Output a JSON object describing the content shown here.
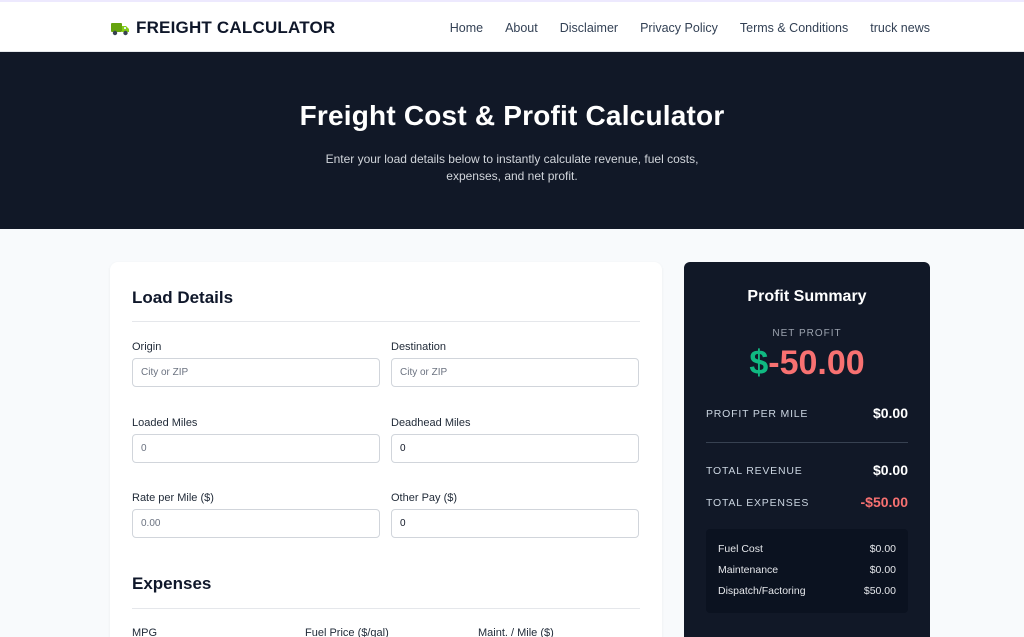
{
  "brand": {
    "name": "FREIGHT CALCULATOR",
    "icon": "truck-icon"
  },
  "nav": [
    "Home",
    "About",
    "Disclaimer",
    "Privacy Policy",
    "Terms & Conditions",
    "truck news"
  ],
  "hero": {
    "title": "Freight Cost & Profit Calculator",
    "subtitle": "Enter your load details below to instantly calculate revenue, fuel costs, expenses, and net profit."
  },
  "load": {
    "title": "Load Details",
    "origin": {
      "label": "Origin",
      "placeholder": "City or ZIP"
    },
    "destination": {
      "label": "Destination",
      "placeholder": "City or ZIP"
    },
    "loaded_miles": {
      "label": "Loaded Miles",
      "placeholder": "0"
    },
    "deadhead_miles": {
      "label": "Deadhead Miles",
      "value": "0"
    },
    "rate": {
      "label": "Rate per Mile ($)",
      "placeholder": "0.00"
    },
    "other_pay": {
      "label": "Other Pay ($)",
      "value": "0"
    }
  },
  "expenses": {
    "title": "Expenses",
    "mpg_label": "MPG",
    "fuel_price_label": "Fuel Price ($/gal)",
    "maint_label": "Maint. / Mile ($)"
  },
  "summary": {
    "title": "Profit Summary",
    "net_label": "NET PROFIT",
    "net_currency": "$",
    "net_amount": "-50.00",
    "ppm_label": "PROFIT PER MILE",
    "ppm_value": "$0.00",
    "revenue_label": "TOTAL REVENUE",
    "revenue_value": "$0.00",
    "expenses_label": "TOTAL EXPENSES",
    "expenses_value": "-$50.00",
    "breakdown": [
      {
        "label": "Fuel Cost",
        "value": "$0.00"
      },
      {
        "label": "Maintenance",
        "value": "$0.00"
      },
      {
        "label": "Dispatch/Factoring",
        "value": "$50.00"
      }
    ]
  },
  "colors": {
    "hero_bg": "#111827",
    "positive": "#10b981",
    "negative": "#f87171"
  }
}
